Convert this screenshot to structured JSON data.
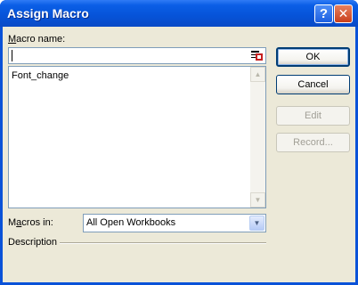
{
  "window": {
    "title": "Assign Macro",
    "help_glyph": "?",
    "close_glyph": "✕"
  },
  "macro_name": {
    "label_prefix": "",
    "label_access_key": "M",
    "label_rest": "acro name:",
    "value": ""
  },
  "macro_list": {
    "items": [
      "Font_change"
    ],
    "scroll_up_glyph": "▲",
    "scroll_down_glyph": "▼"
  },
  "buttons": {
    "ok": "OK",
    "cancel": "Cancel",
    "edit": "Edit",
    "record": "Record..."
  },
  "macros_in": {
    "label_prefix": "M",
    "label_access_key": "a",
    "label_rest": "cros in:",
    "selected": "All Open Workbooks",
    "drop_glyph": "▼"
  },
  "description": {
    "label": "Description"
  }
}
